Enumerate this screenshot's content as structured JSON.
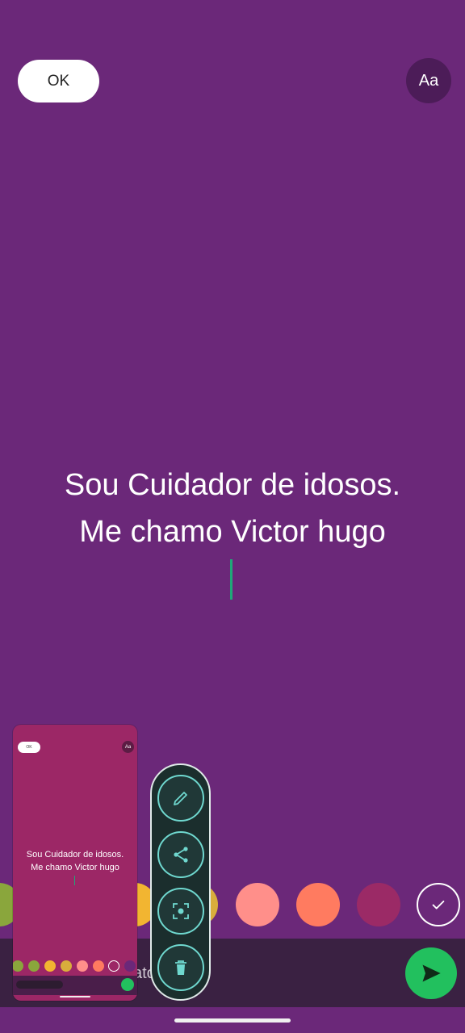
{
  "header": {
    "ok_label": "OK",
    "font_label": "Aa"
  },
  "status": {
    "line1": "Sou Cuidador de idosos.",
    "line2": "Me chamo Victor hugo"
  },
  "colors": {
    "background": "#6b2879",
    "caret": "#1fa978",
    "send": "#22c05e",
    "swatches": [
      "#8aa63c",
      "#f2b531",
      "#d9ad3c",
      "#ff8f8a",
      "#ff7b60",
      "#9b2a66"
    ]
  },
  "composer": {
    "partial_text": "ato"
  },
  "preview": {
    "ok_label": "OK",
    "font_label": "Aa",
    "line1": "Sou Cuidador de idosos.",
    "line2": "Me chamo Victor hugo",
    "swatches": [
      "#8aa63c",
      "#8aa63c",
      "#f2b531",
      "#d9ad3c",
      "#ff8f8a",
      "#ff7b60"
    ]
  },
  "actions": [
    "pencil-icon",
    "share-icon",
    "scan-icon",
    "trash-icon"
  ]
}
